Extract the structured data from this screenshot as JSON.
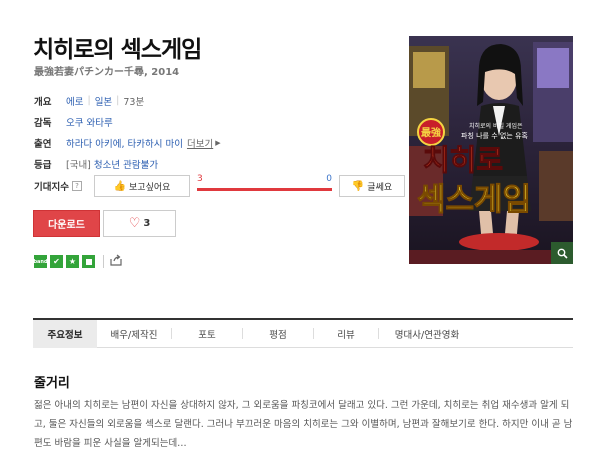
{
  "movie": {
    "title": "치히로의 섹스게임",
    "subtitle": "最強若妻パチンカー千尋, 2014"
  },
  "info": {
    "overview": {
      "label": "개요",
      "genre": "에로",
      "country": "일본",
      "runtime": "73분"
    },
    "director": {
      "label": "감독",
      "name": "오쿠 와타루"
    },
    "cast": {
      "label": "출연",
      "names": "하라다 아키에, 타카하시 마이",
      "more": "더보기"
    },
    "rating": {
      "label": "등급",
      "region": "[국내]",
      "value": "청소년 관람불가"
    }
  },
  "anticipation": {
    "label": "기대지수",
    "help": "?",
    "want_label": "보고싶어요",
    "want_count": "3",
    "notwant_count": "0",
    "notwant_label": "글쎄요",
    "want_ratio": 1.0
  },
  "actions": {
    "download": "다운로드",
    "like_count": "3"
  },
  "share": {
    "icons": [
      "band-icon",
      "kakao-icon",
      "star-icon",
      "green-box-icon"
    ]
  },
  "tabs": [
    "주요정보",
    "배우/제작진",
    "포토",
    "평점",
    "리뷰",
    "명대사/연관영화"
  ],
  "synopsis": {
    "title": "줄거리",
    "text": "젊은 아내의 치히로는 남편이 자신을 상대하지 않자, 그 외로움을 파칭코에서 달래고 있다. 그런 가운데, 치히로는 취업 재수생과 알게 되고, 둘은 자신들의 외로움을 섹스로 달랜다. 그러나 부끄러운 마음의 치히로는 그와 이별하며, 남편과 잘해보기로 한다. 하지만 이내 곧 남편도 바람을 피운 사실을 알게되는데…"
  },
  "poster": {
    "badge": "最強",
    "tagline_1": "치히로의 비밀 게임은",
    "tagline_2": "파칭 나를 수 없는 유혹",
    "title_line_1": "치히로",
    "title_line_2": "섹스게임"
  },
  "colors": {
    "accent_red": "#e04548",
    "link_blue": "#2a5db0",
    "share_green": "#33a43a"
  }
}
